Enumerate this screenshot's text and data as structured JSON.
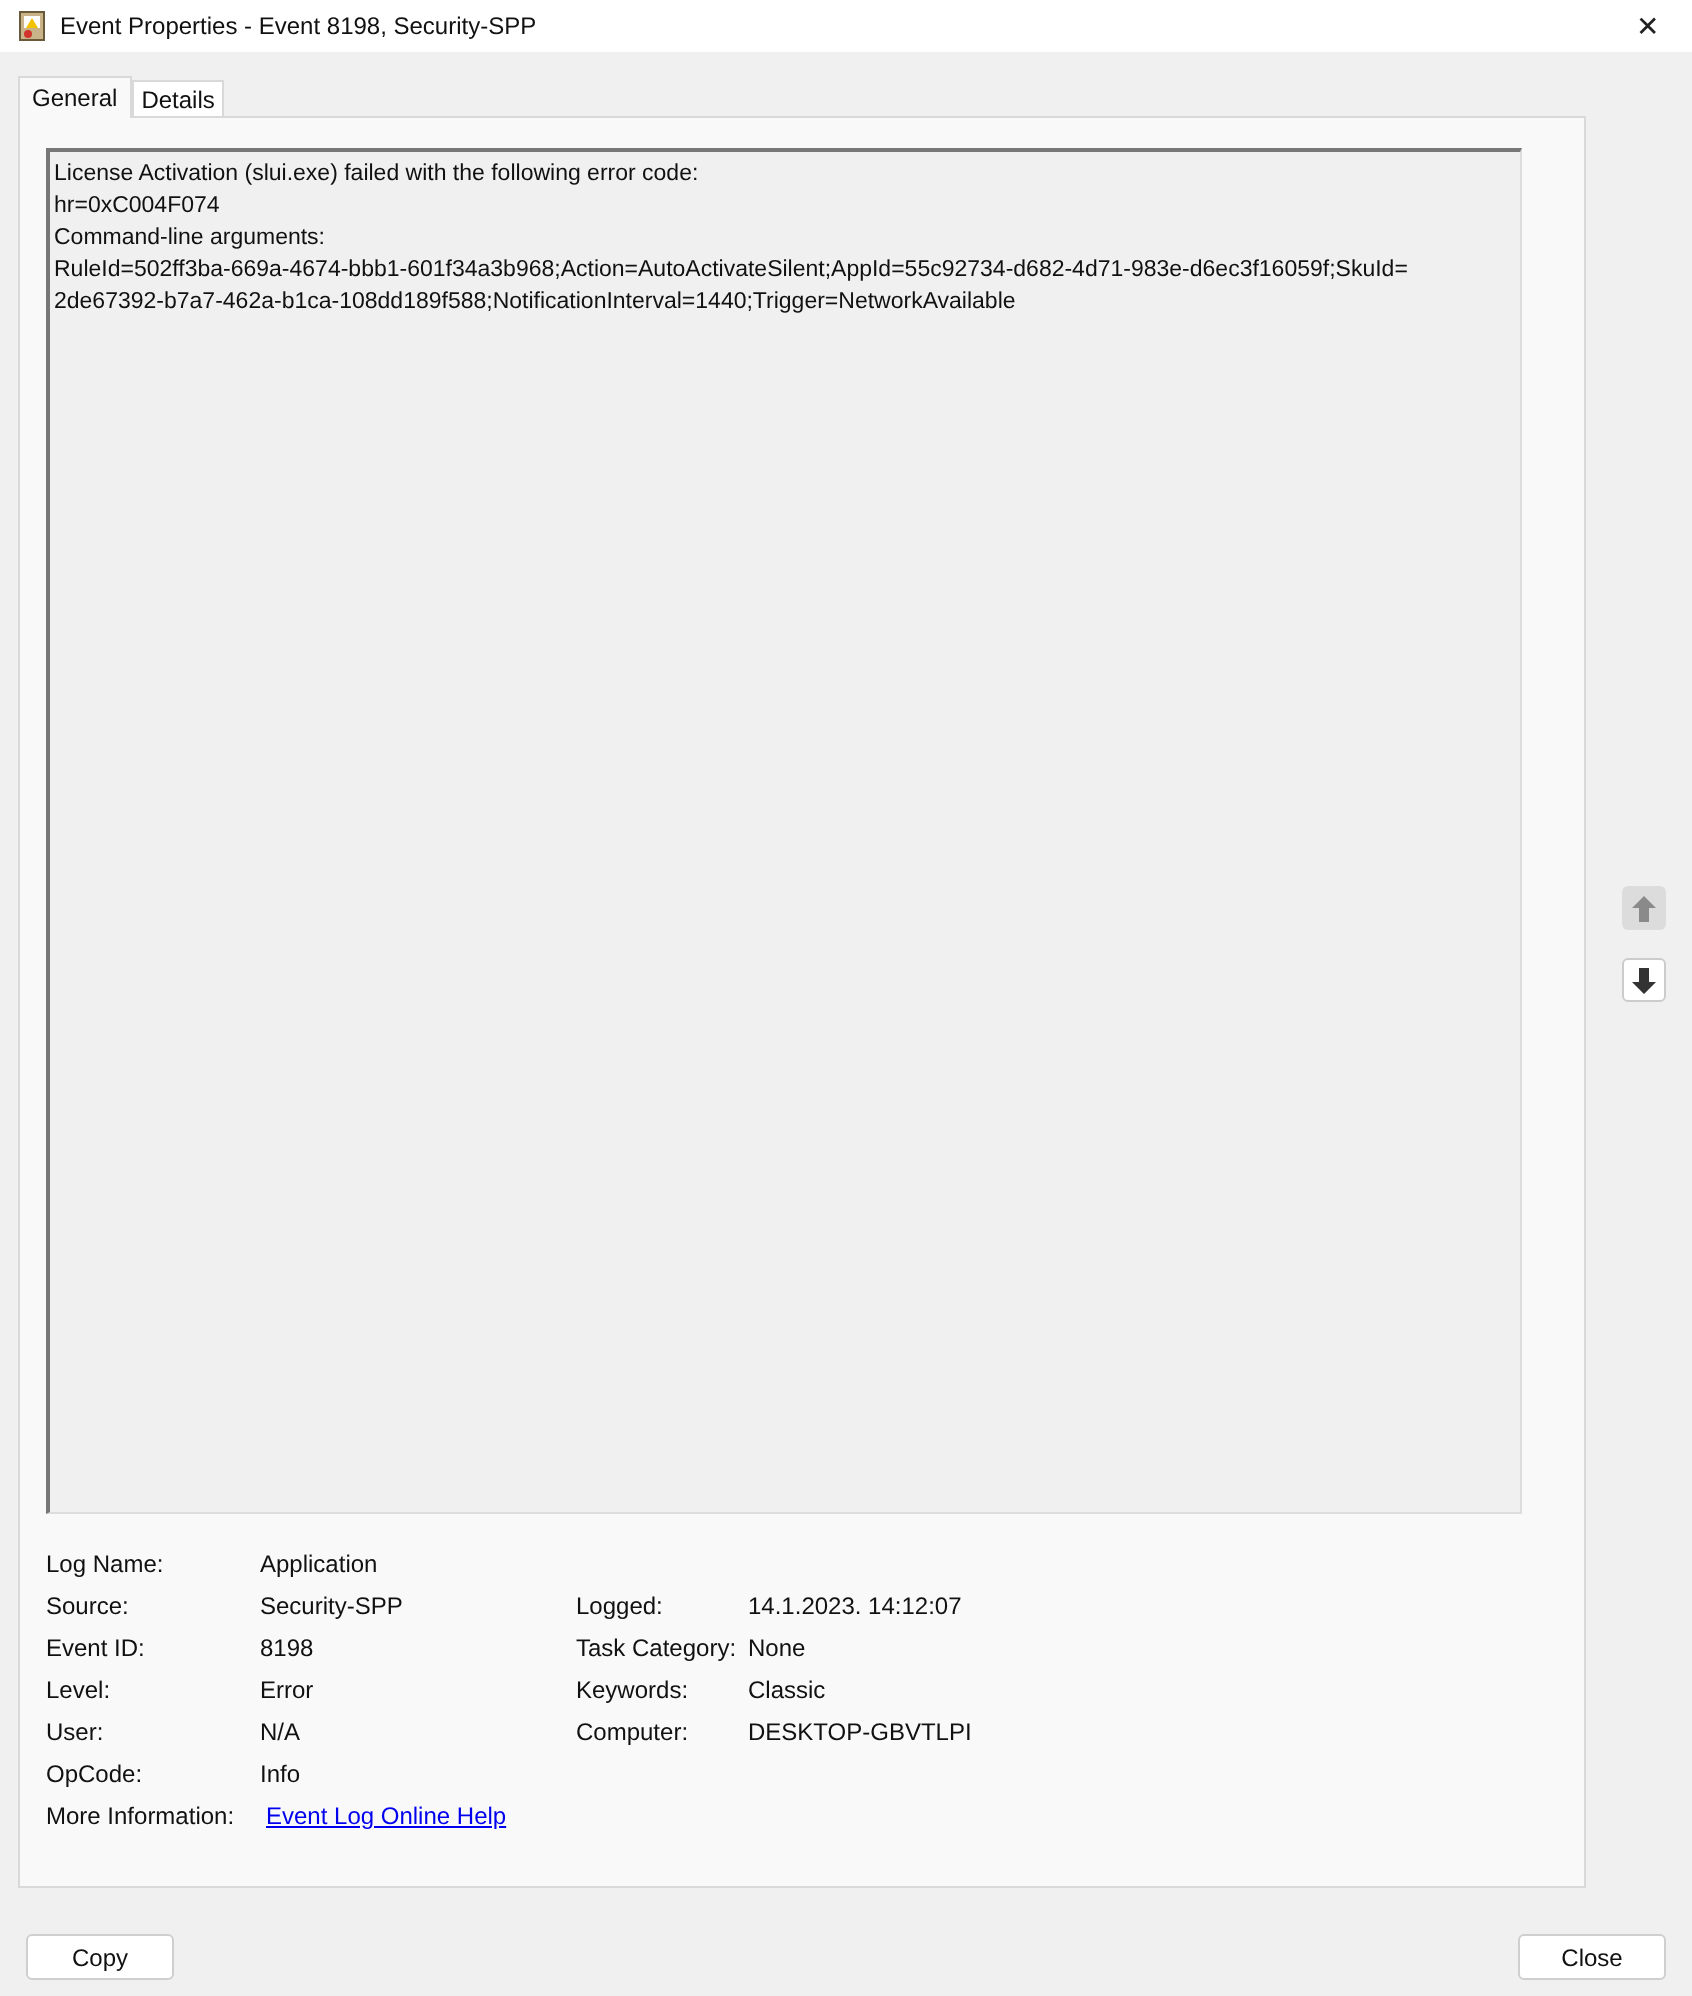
{
  "window": {
    "title": "Event Properties - Event 8198, Security-SPP",
    "close": "✕"
  },
  "tabs": [
    {
      "label": "General",
      "selected": true
    },
    {
      "label": "Details",
      "selected": false
    }
  ],
  "message": [
    "License Activation (slui.exe) failed with the following error code:",
    "hr=0xC004F074",
    "Command-line arguments:",
    "RuleId=502ff3ba-669a-4674-bbb1-601f34a3b968;Action=AutoActivateSilent;AppId=55c92734-d682-4d71-983e-d6ec3f16059f;SkuId=",
    "2de67392-b7a7-462a-b1ca-108dd189f588;NotificationInterval=1440;Trigger=NetworkAvailable"
  ],
  "nav_buttons": [
    {
      "kind": "up",
      "disabled": true
    },
    {
      "kind": "down",
      "disabled": false
    }
  ],
  "rows": [
    {
      "left": {
        "label": "Log Name:",
        "value": "Application"
      }
    },
    {
      "left": {
        "label": "Source:",
        "value": "Security-SPP"
      },
      "right": {
        "label": "Logged:",
        "value": "14.1.2023. 14:12:07"
      }
    },
    {
      "left": {
        "label": "Event ID:",
        "value": "8198"
      },
      "right": {
        "label": "Task Category:",
        "value": "None"
      }
    },
    {
      "left": {
        "label": "Level:",
        "value": "Error"
      },
      "right": {
        "label": "Keywords:",
        "value": "Classic"
      }
    },
    {
      "left": {
        "label": "User:",
        "value": "N/A"
      },
      "right": {
        "label": "Computer:",
        "value": "DESKTOP-GBVTLPI"
      }
    },
    {
      "left": {
        "label": "OpCode:",
        "value": "Info"
      }
    },
    {
      "left": {
        "label": "More Information:",
        "value": "Event Log Online Help",
        "kind": "link"
      }
    }
  ],
  "buttons": [
    "Copy",
    "Close"
  ]
}
